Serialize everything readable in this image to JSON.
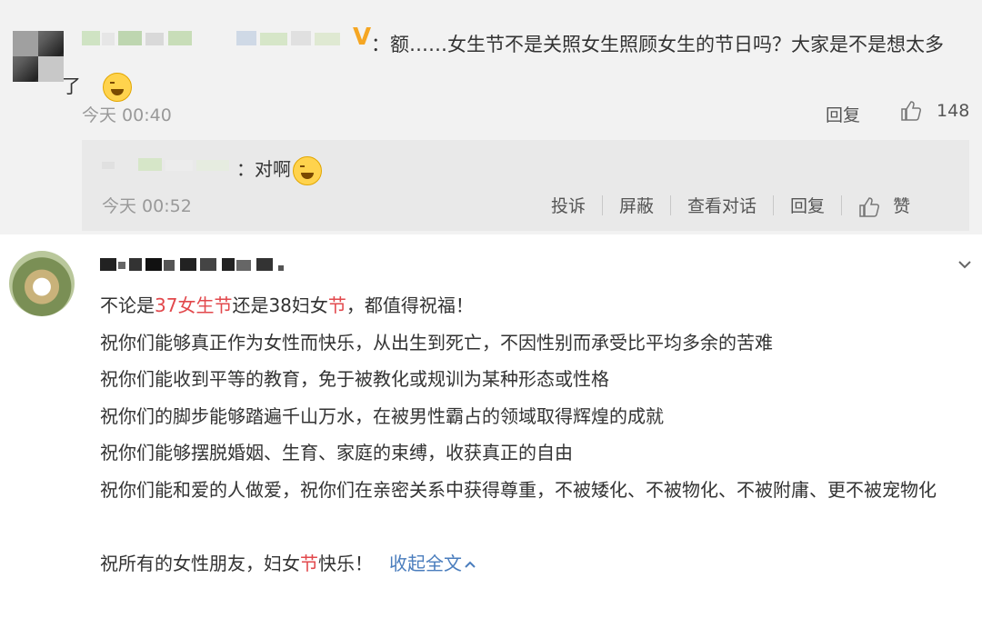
{
  "comment1": {
    "badge": "V",
    "text": "：额……女生节不是关照女生照顾女生的节日吗？大家是不是想太多了",
    "emoji": "laughing-crying-emoji",
    "time": "今天 00:40",
    "reply_label": "回复",
    "like_count": "148",
    "sub_reply": {
      "text": "：对啊",
      "emoji": "crying-emoji",
      "time": "今天 00:52",
      "actions": [
        "投诉",
        "屏蔽",
        "查看对话",
        "回复"
      ],
      "like_label": "赞"
    }
  },
  "comment2": {
    "line1": {
      "a": "不论是",
      "b": "37女生节",
      "c": "还是38妇女",
      "d": "节",
      "e": "，都值得祝福！"
    },
    "lines": [
      "祝你们能够真正作为女性而快乐，从出生到死亡，不因性别而承受比平均多余的苦难",
      "祝你们能收到平等的教育，免于被教化或规训为某种形态或性格",
      "祝你们的脚步能够踏遍千山万水，在被男性霸占的领域取得辉煌的成就",
      "祝你们能够摆脱婚姻、生育、家庭的束缚，收获真正的自由",
      "祝你们能和爱的人做爱，祝你们在亲密关系中获得尊重，不被矮化、不被物化、不被附庸、更不被宠物化"
    ],
    "last": {
      "a": "祝所有的女性朋友，妇女",
      "b": "节",
      "c": "快乐！",
      "collapse": "收起全文"
    }
  },
  "colors": {
    "highlight": "#e2484c",
    "link": "#4a7dbd",
    "vip": "#f5a623"
  }
}
